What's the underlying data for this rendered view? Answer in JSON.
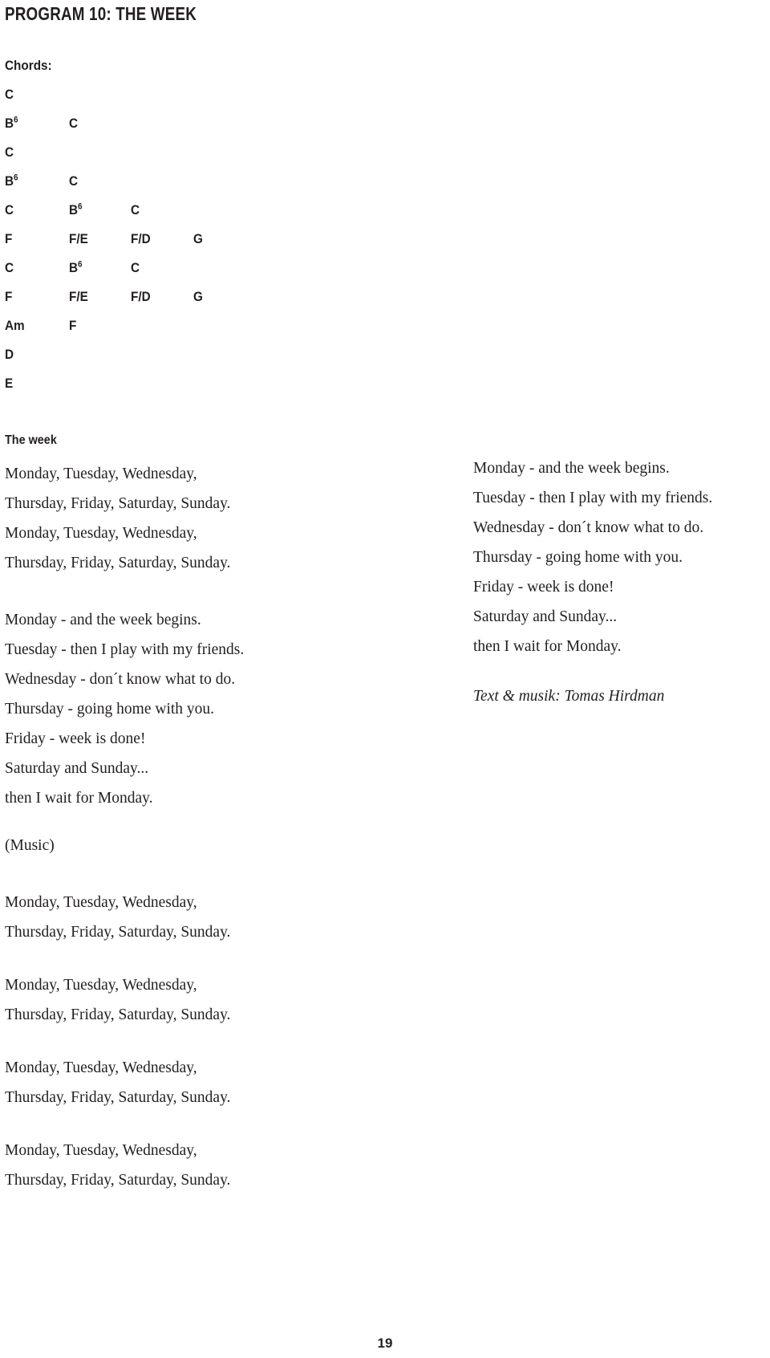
{
  "page": {
    "title": "PROGRAM 10: THE WEEK",
    "page_number": "19",
    "text_color": "#231f20",
    "background_color": "#ffffff"
  },
  "chords": {
    "label": "Chords:",
    "rows": [
      [
        {
          "root": "C",
          "sup": ""
        }
      ],
      [
        {
          "root": "B",
          "sup": "6"
        },
        {
          "root": "C",
          "sup": ""
        }
      ],
      [
        {
          "root": "C",
          "sup": ""
        }
      ],
      [
        {
          "root": "B",
          "sup": "6"
        },
        {
          "root": "C",
          "sup": ""
        }
      ],
      [
        {
          "root": "C",
          "sup": ""
        },
        {
          "root": "B",
          "sup": "6"
        },
        {
          "root": "C",
          "sup": ""
        }
      ],
      [
        {
          "root": "F",
          "sup": ""
        },
        {
          "root": "F/E",
          "sup": ""
        },
        {
          "root": "F/D",
          "sup": ""
        },
        {
          "root": "G",
          "sup": ""
        }
      ],
      [
        {
          "root": "C",
          "sup": ""
        },
        {
          "root": "B",
          "sup": "6"
        },
        {
          "root": "C",
          "sup": ""
        }
      ],
      [
        {
          "root": "F",
          "sup": ""
        },
        {
          "root": "F/E",
          "sup": ""
        },
        {
          "root": "F/D",
          "sup": ""
        },
        {
          "root": "G",
          "sup": ""
        }
      ],
      [
        {
          "root": "Am",
          "sup": ""
        },
        {
          "root": "F",
          "sup": ""
        }
      ],
      [
        {
          "root": "D",
          "sup": ""
        }
      ],
      [
        {
          "root": "E",
          "sup": ""
        }
      ]
    ]
  },
  "lyrics": {
    "song_heading": "The week",
    "left_column": {
      "verse1": [
        "Monday, Tuesday, Wednesday,",
        "Thursday, Friday, Saturday, Sunday.",
        "Monday, Tuesday, Wednesday,",
        "Thursday, Friday, Saturday, Sunday."
      ],
      "verse2": [
        "Monday - and the week begins.",
        "Tuesday - then I play with my friends.",
        "Wednesday - don´t know what to do.",
        "Thursday - going home with you.",
        "Friday - week is done!",
        "Saturday and Sunday...",
        "then I wait for Monday."
      ]
    },
    "right_column": {
      "verse": [
        "Monday - and the week begins.",
        "Tuesday - then I play with my friends.",
        "Wednesday - don´t know what to do.",
        "Thursday - going home with you.",
        "Friday - week is done!",
        "Saturday and Sunday...",
        "then I wait for Monday."
      ],
      "credits": "Text & musik: Tomas Hirdman"
    },
    "lower_section": {
      "music_cue": "(Music)",
      "refrains": [
        [
          "Monday, Tuesday, Wednesday,",
          "Thursday, Friday, Saturday, Sunday."
        ],
        [
          "Monday, Tuesday, Wednesday,",
          "Thursday, Friday, Saturday, Sunday."
        ],
        [
          "Monday, Tuesday, Wednesday,",
          "Thursday, Friday, Saturday, Sunday."
        ],
        [
          "Monday, Tuesday, Wednesday,",
          "Thursday, Friday, Saturday, Sunday."
        ]
      ]
    }
  }
}
